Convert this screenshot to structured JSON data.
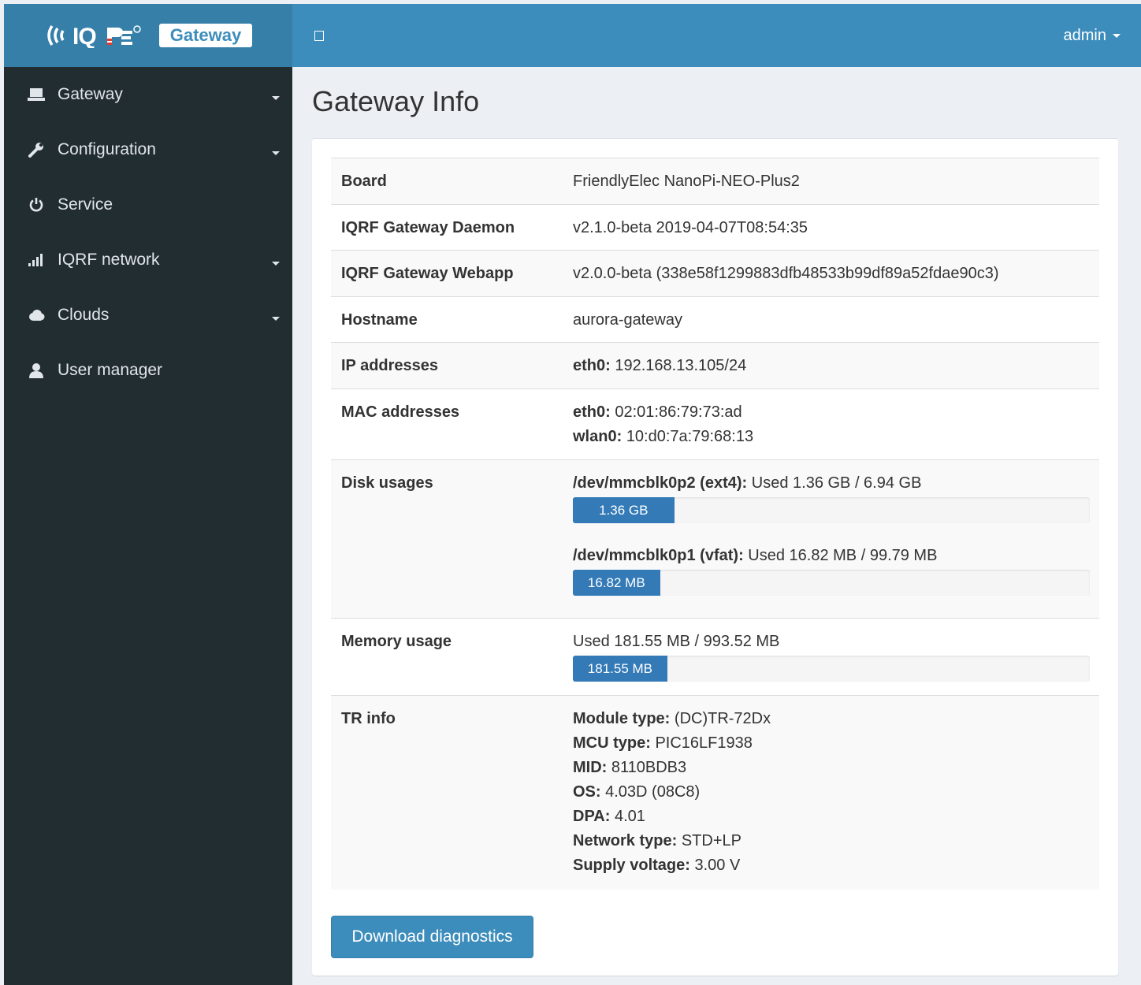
{
  "brand": {
    "logo_text": "IQRF",
    "badge": "Gateway"
  },
  "header": {
    "user": "admin"
  },
  "sidebar": {
    "items": [
      {
        "label": "Gateway",
        "icon": "laptop-icon",
        "has_submenu": true
      },
      {
        "label": "Configuration",
        "icon": "wrench-icon",
        "has_submenu": true
      },
      {
        "label": "Service",
        "icon": "power-icon",
        "has_submenu": false
      },
      {
        "label": "IQRF network",
        "icon": "signal-icon",
        "has_submenu": true
      },
      {
        "label": "Clouds",
        "icon": "cloud-icon",
        "has_submenu": true
      },
      {
        "label": "User manager",
        "icon": "user-icon",
        "has_submenu": false
      }
    ]
  },
  "page": {
    "title": "Gateway Info"
  },
  "info": {
    "board": {
      "label": "Board",
      "value": "FriendlyElec NanoPi-NEO-Plus2"
    },
    "daemon": {
      "label": "IQRF Gateway Daemon",
      "value": "v2.1.0-beta 2019-04-07T08:54:35"
    },
    "webapp": {
      "label": "IQRF Gateway Webapp",
      "value": "v2.0.0-beta (338e58f1299883dfb48533b99df89a52fdae90c3)"
    },
    "hostname": {
      "label": "Hostname",
      "value": "aurora-gateway"
    },
    "ip": {
      "label": "IP addresses",
      "entries": [
        {
          "iface": "eth0:",
          "value": "192.168.13.105/24"
        }
      ]
    },
    "mac": {
      "label": "MAC addresses",
      "entries": [
        {
          "iface": "eth0:",
          "value": "02:01:86:79:73:ad"
        },
        {
          "iface": "wlan0:",
          "value": "10:d0:7a:79:68:13"
        }
      ]
    },
    "disks": {
      "label": "Disk usages",
      "entries": [
        {
          "device": "/dev/mmcblk0p2 (ext4):",
          "text": "Used 1.36 GB / 6.94 GB",
          "bar_label": "1.36 GB",
          "fraction": 0.196
        },
        {
          "device": "/dev/mmcblk0p1 (vfat):",
          "text": "Used 16.82 MB / 99.79 MB",
          "bar_label": "16.82 MB",
          "fraction": 0.1686
        }
      ]
    },
    "memory": {
      "label": "Memory usage",
      "text": "Used 181.55 MB / 993.52 MB",
      "bar_label": "181.55 MB",
      "fraction": 0.1827
    },
    "tr": {
      "label": "TR info",
      "entries": [
        {
          "key": "Module type:",
          "value": "(DC)TR-72Dx"
        },
        {
          "key": "MCU type:",
          "value": "PIC16LF1938"
        },
        {
          "key": "MID:",
          "value": "8110BDB3"
        },
        {
          "key": "OS:",
          "value": "4.03D (08C8)"
        },
        {
          "key": "DPA:",
          "value": "4.01"
        },
        {
          "key": "Network type:",
          "value": "STD+LP"
        },
        {
          "key": "Supply voltage:",
          "value": "3.00 V"
        }
      ]
    }
  },
  "actions": {
    "download": "Download diagnostics"
  },
  "colors": {
    "header": "#3c8dbc",
    "logo_bar": "#367fa9",
    "sidebar": "#222d32",
    "progress": "#337ab7",
    "background": "#ecf0f5"
  }
}
